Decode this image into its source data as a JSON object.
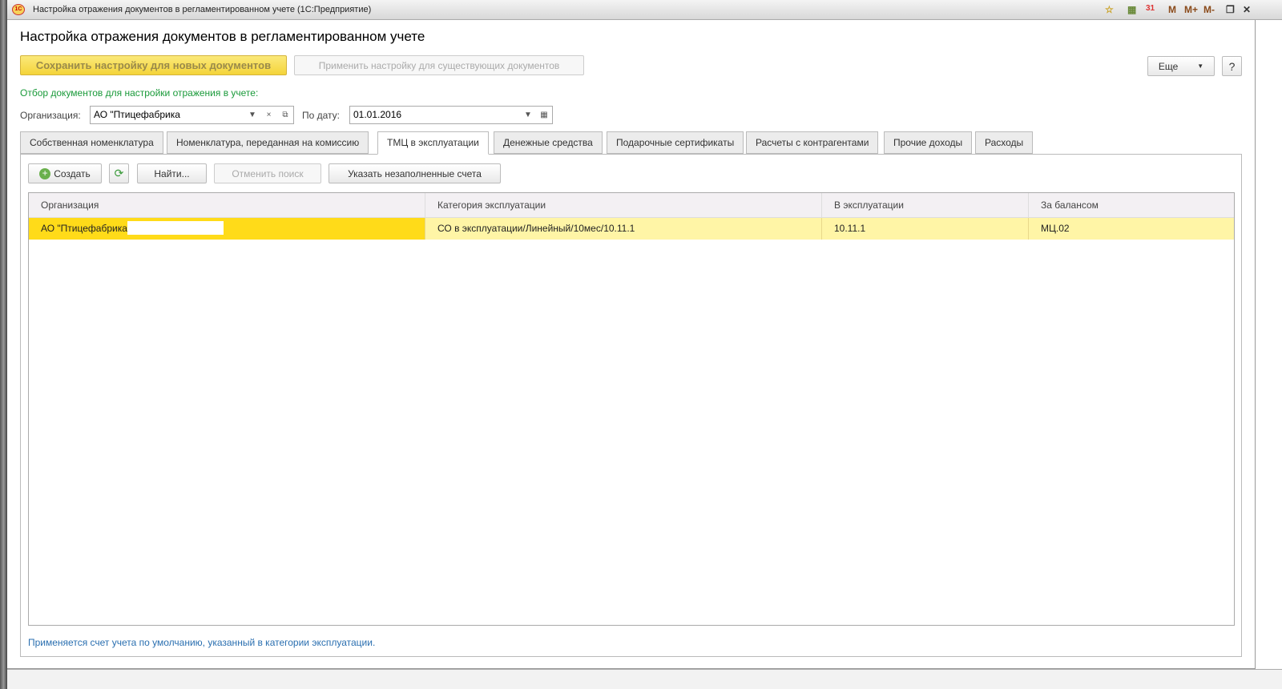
{
  "window": {
    "title": "Настройка отражения документов в регламентированном учете  (1С:Предприятие)",
    "logo": "1С",
    "toolbar_icons": [
      "favorite-icon",
      "calculator-icon",
      "calendar-icon"
    ],
    "calendar_day": "31",
    "memory": [
      "M",
      "M+",
      "M-"
    ]
  },
  "page_title": "Настройка отражения документов в регламентированном учете",
  "actions": {
    "save": "Сохранить настройку для новых документов",
    "apply": "Применить настройку для существующих документов",
    "more": "Еще",
    "help": "?"
  },
  "filter": {
    "heading": "Отбор документов для настройки отражения в учете:",
    "org_label": "Организация:",
    "org_value": "АО \"Птицефабрика",
    "date_label": "По дату:",
    "date_value": "01.01.2016"
  },
  "tabs": [
    "Собственная номенклатура",
    "Номенклатура, переданная на комиссию",
    "ТМЦ в эксплуатации",
    "Денежные средства",
    "Подарочные сертификаты",
    "Расчеты с контрагентами",
    "Прочие доходы",
    "Расходы"
  ],
  "active_tab": 2,
  "list_toolbar": {
    "create": "Создать",
    "find": "Найти...",
    "cancel_search": "Отменить поиск",
    "specify": "Указать незаполненные счета"
  },
  "table": {
    "columns": [
      "Организация",
      "Категория эксплуатации",
      "В эксплуатации",
      "За балансом"
    ],
    "rows": [
      [
        "АО \"Птицефабрика",
        "СО в эксплуатации/Линейный/10мес/10.11.1",
        "10.11.1",
        "МЦ.02"
      ]
    ]
  },
  "footer_note": "Применяется счет учета по умолчанию, указанный в категории эксплуатации.",
  "colors": {
    "accent_yellow": "#ffdb19",
    "row_yellow": "#fff5a6",
    "green": "#1a9a3a",
    "link_blue": "#2a6fb0"
  }
}
